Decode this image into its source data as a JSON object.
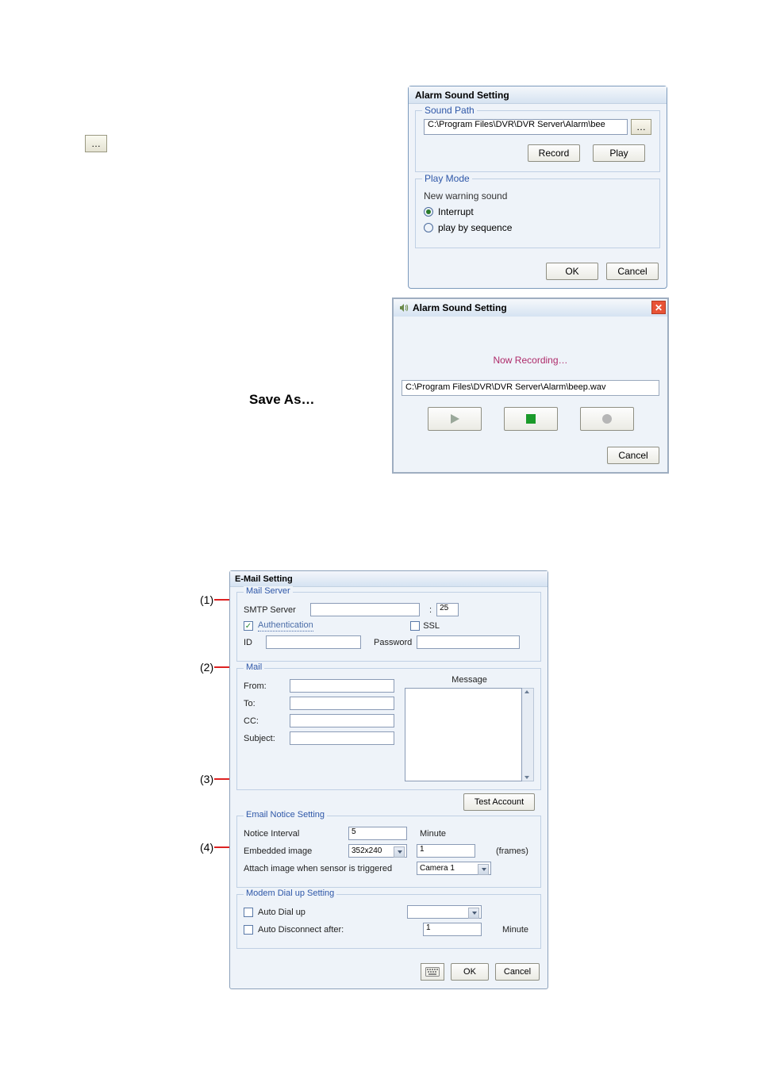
{
  "browse_button_label": "…",
  "save_as_label": "Save As…",
  "dlg1": {
    "title": "Alarm Sound Setting",
    "sound_path_legend": "Sound Path",
    "path_value": "C:\\Program Files\\DVR\\DVR Server\\Alarm\\bee",
    "browse_label": "…",
    "record_btn": "Record",
    "play_btn": "Play",
    "play_mode_legend": "Play Mode",
    "play_mode_desc": "New warning sound",
    "opt_interrupt": "Interrupt",
    "opt_sequence": "play by sequence",
    "ok": "OK",
    "cancel": "Cancel"
  },
  "dlg2": {
    "title": "Alarm Sound Setting",
    "status": "Now Recording…",
    "path_value": "C:\\Program Files\\DVR\\DVR Server\\Alarm\\beep.wav",
    "cancel": "Cancel"
  },
  "dlg3": {
    "title": "E-Mail Setting",
    "mail_server_legend": "Mail Server",
    "smtp_server_label": "SMTP Server",
    "port_sep": ":",
    "port_value": "25",
    "auth_label": "Authentication",
    "ssl_label": "SSL",
    "id_label": "ID",
    "password_label": "Password",
    "mail_legend": "Mail",
    "message_label": "Message",
    "from_label": "From:",
    "to_label": "To:",
    "cc_label": "CC:",
    "subject_label": "Subject:",
    "test_account_btn": "Test Account",
    "email_notice_legend": "Email Notice Setting",
    "notice_interval_label": "Notice Interval",
    "notice_interval_value": "5",
    "minute_label": "Minute",
    "embedded_image_label": "Embedded image",
    "resolution_value": "352x240",
    "frames_value": "1",
    "frames_unit": "(frames)",
    "attach_label": "Attach image when sensor is triggered",
    "camera_value": "Camera 1",
    "modem_legend": "Modem Dial up Setting",
    "auto_dial_label": "Auto Dial up",
    "auto_disconnect_label": "Auto Disconnect after:",
    "auto_disconnect_value": "1",
    "auto_disconnect_unit": "Minute",
    "ok": "OK",
    "cancel": "Cancel"
  },
  "callouts": {
    "c1": "(1)",
    "c2": "(2)",
    "c3": "(3)",
    "c4": "(4)"
  }
}
